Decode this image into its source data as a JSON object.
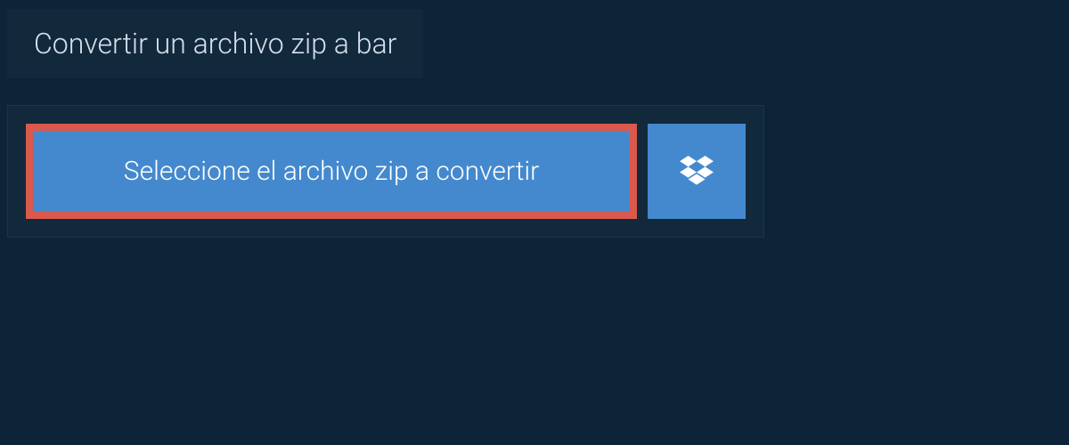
{
  "header": {
    "title": "Convertir un archivo zip a bar"
  },
  "upload": {
    "select_label": "Seleccione el archivo zip a convertir"
  },
  "icons": {
    "dropbox": "dropbox-icon"
  },
  "colors": {
    "background": "#0d2438",
    "panel": "#12283b",
    "accent": "#4489ce",
    "highlight_border": "#d9594c"
  }
}
